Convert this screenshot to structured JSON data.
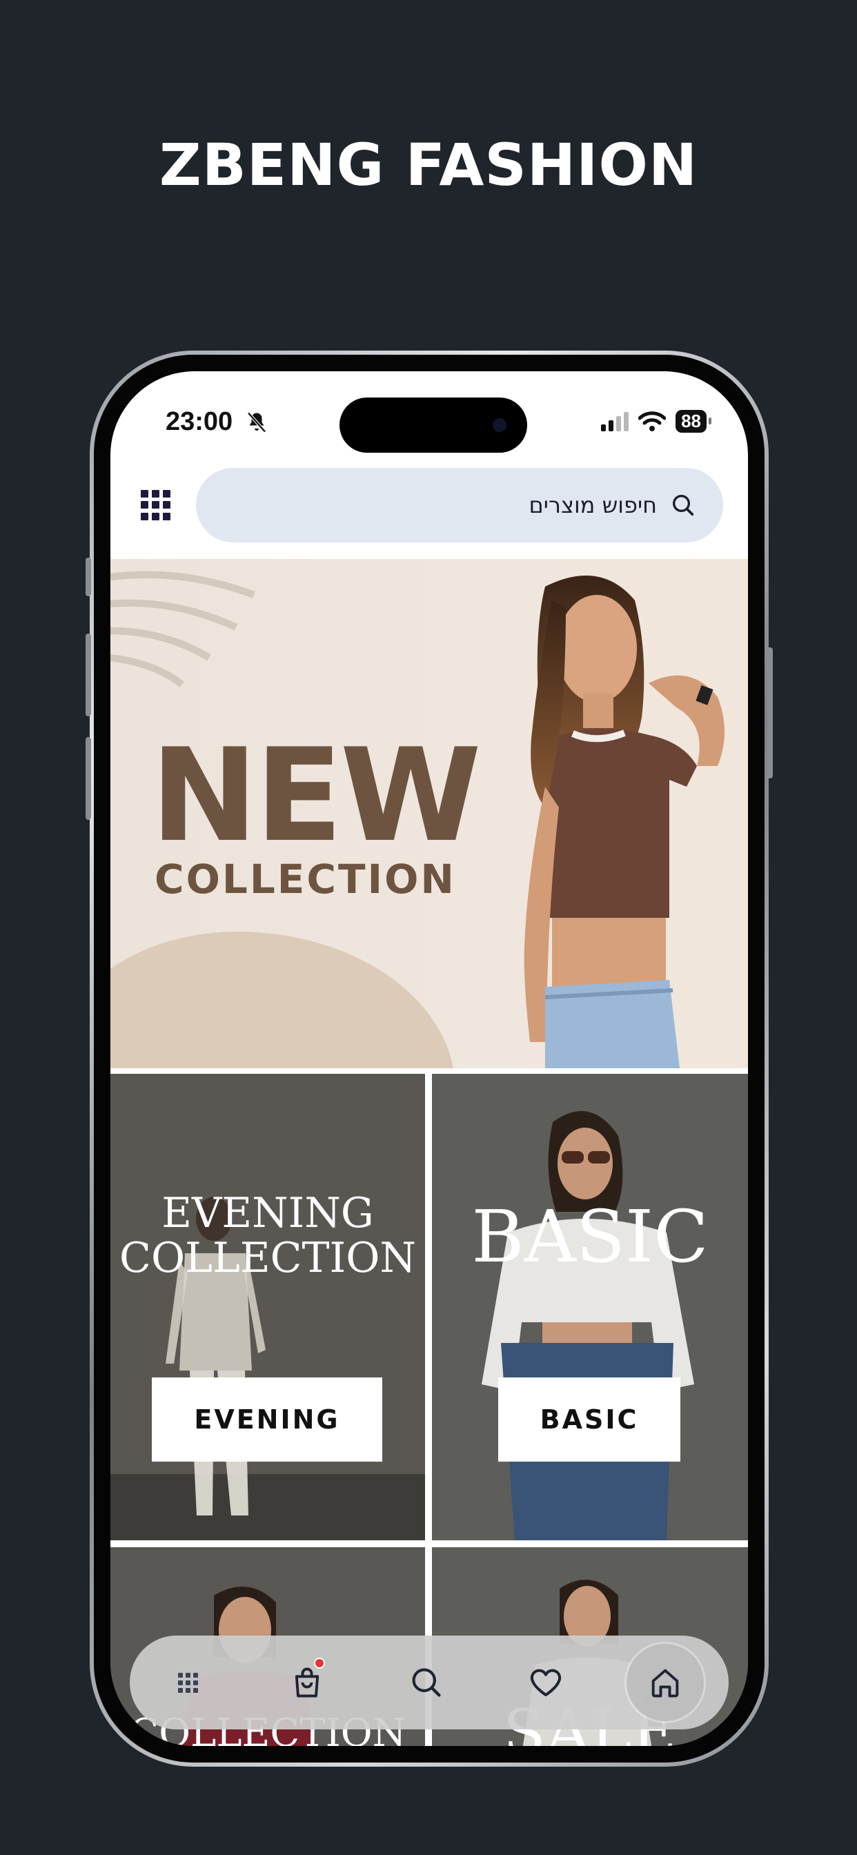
{
  "promo": {
    "title": "ZBENG FASHION"
  },
  "status_bar": {
    "time": "23:00",
    "battery": "88"
  },
  "search": {
    "placeholder": "חיפוש מוצרים"
  },
  "hero": {
    "headline": "NEW",
    "subheadline": "COLLECTION"
  },
  "categories": [
    {
      "title_line1": "EVENING",
      "title_line2": "COLLECTION",
      "button": "EVENING"
    },
    {
      "title_line1": "BASIC",
      "button": "BASIC"
    },
    {
      "title_line1": "COLLECTION"
    },
    {
      "title_line1": "SALE"
    }
  ],
  "bottom_nav": {
    "items": [
      "menu-icon",
      "shopping-bag-icon",
      "search-icon",
      "heart-icon",
      "home-icon"
    ],
    "active": "home",
    "cart_badge_color": "#e8333b"
  },
  "colors": {
    "background": "#20242b",
    "hero_text": "#6d5441",
    "search_bg": "#e1e7f0",
    "menu_icon": "#1d1b3d"
  }
}
